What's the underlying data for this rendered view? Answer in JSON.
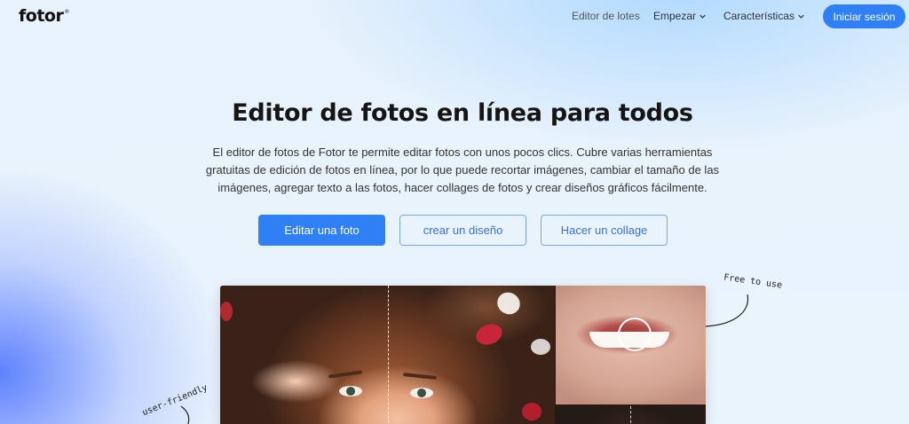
{
  "header": {
    "logo": "fotor",
    "logo_mark": "®",
    "nav": [
      {
        "label": "Editor de lotes",
        "has_dropdown": false
      },
      {
        "label": "Empezar",
        "has_dropdown": true
      },
      {
        "label": "Características",
        "has_dropdown": true
      }
    ],
    "login_label": "Iniciar sesión"
  },
  "hero": {
    "title": "Editor de fotos en línea para todos",
    "description": "El editor de fotos de Fotor te permite editar fotos con unos pocos clics. Cubre varias herramientas gratuitas de edición de fotos en línea, por lo que puede recortar imágenes, cambiar el tamaño de las imágenes, agregar texto a las fotos, hacer collages de fotos y crear diseños gráficos fácilmente.",
    "buttons": {
      "primary": "Editar una foto",
      "secondary": "crear un diseño",
      "tertiary": "Hacer un collage"
    }
  },
  "annotations": {
    "free": "Free to use",
    "friendly": "user-friendly"
  },
  "colors": {
    "accent": "#2f80f5",
    "outline": "#7aa6ee"
  },
  "icons": {
    "dropdown": "chevron-down-icon",
    "arrow": "hand-drawn-arrow-icon"
  }
}
